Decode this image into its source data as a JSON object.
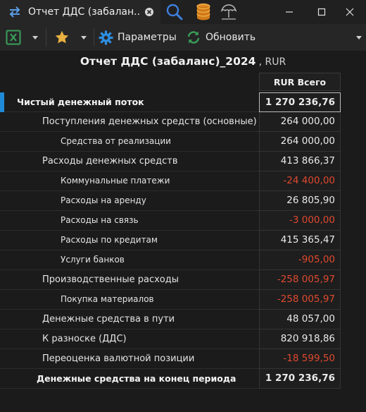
{
  "window": {
    "tab_title": "Отчет ДДС (забалан...",
    "icons": [
      "switch-arrows-icon",
      "close-icon",
      "search-icon",
      "database-icon",
      "umbrella-icon",
      "minimize-icon",
      "maximize-icon",
      "close-window-icon"
    ]
  },
  "toolbar": {
    "params_label": "Параметры",
    "refresh_label": "Обновить"
  },
  "report": {
    "title": "Отчет ДДС (забаланс)_2024",
    "currency": ", RUR",
    "column_header": "RUR Всего",
    "colors": {
      "negative": "#e0492f",
      "accent": "#1f8ad8"
    },
    "rows": [
      {
        "label": "Чистый денежный поток",
        "value": "1 270 236,76",
        "level": 0,
        "negative": false,
        "selected": true
      },
      {
        "label": "Поступления денежных средств (основные)",
        "value": "264 000,00",
        "level": 1,
        "negative": false
      },
      {
        "label": "Средства от реализации",
        "value": "264 000,00",
        "level": 2,
        "negative": false
      },
      {
        "label": "Расходы денежных средств",
        "value": "413 866,37",
        "level": 1,
        "negative": false
      },
      {
        "label": "Коммунальные платежи",
        "value": "-24 400,00",
        "level": 2,
        "negative": true
      },
      {
        "label": "Расходы на аренду",
        "value": "26 805,90",
        "level": 2,
        "negative": false
      },
      {
        "label": "Расходы на связь",
        "value": "-3 000,00",
        "level": 2,
        "negative": true
      },
      {
        "label": "Расходы по кредитам",
        "value": "415 365,47",
        "level": 2,
        "negative": false
      },
      {
        "label": "Услуги банков",
        "value": "-905,00",
        "level": 2,
        "negative": true
      },
      {
        "label": "Производственные расходы",
        "value": "-258 005,97",
        "level": 1,
        "negative": true
      },
      {
        "label": "Покупка материалов",
        "value": "-258 005,97",
        "level": 2,
        "negative": true
      },
      {
        "label": "Денежные средства в пути",
        "value": "48 057,00",
        "level": 1,
        "negative": false
      },
      {
        "label": "К разноске (ДДС)",
        "value": "820 918,86",
        "level": 1,
        "negative": false
      },
      {
        "label": "Переоценка валютной позиции",
        "value": "-18 599,50",
        "level": 1,
        "negative": true
      },
      {
        "label": "Денежные средства на конец периода",
        "value": "1 270 236,76",
        "level": "total",
        "negative": false
      }
    ]
  }
}
